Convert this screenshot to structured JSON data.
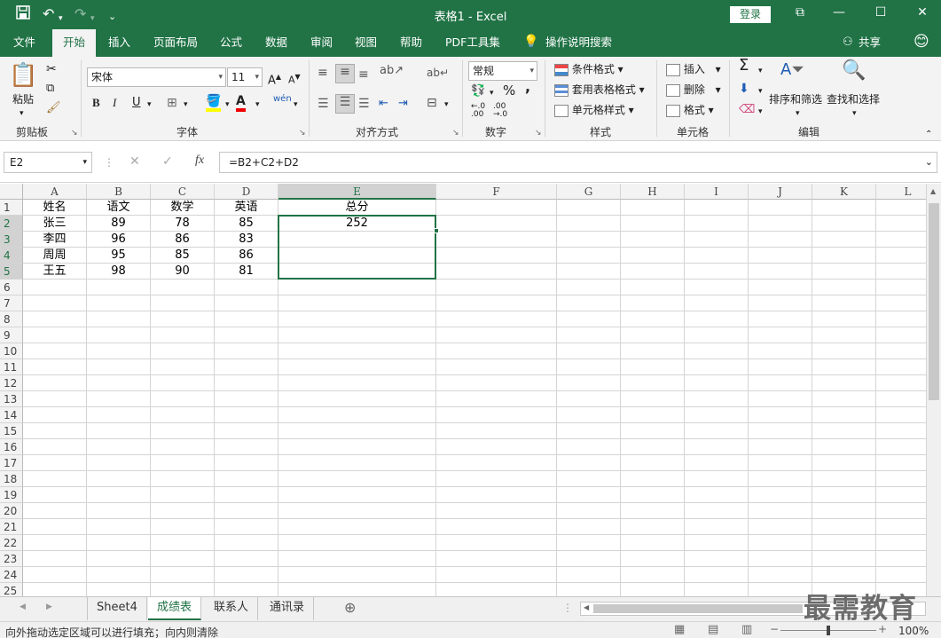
{
  "titlebar": {
    "title": "表格1  -  Excel",
    "login": "登录",
    "save_icon": "save-icon",
    "undo_icon": "undo-icon",
    "redo_icon": "redo-icon"
  },
  "tabs": [
    "文件",
    "开始",
    "插入",
    "页面布局",
    "公式",
    "数据",
    "审阅",
    "视图",
    "帮助",
    "PDF工具集",
    "操作说明搜索"
  ],
  "share": "共享",
  "ribbon": {
    "clipboard": {
      "paste": "粘贴",
      "label": "剪贴板"
    },
    "font": {
      "name": "宋体",
      "size": "11",
      "label": "字体",
      "bold": "B",
      "italic": "I",
      "underline": "U"
    },
    "alignment": {
      "label": "对齐方式"
    },
    "number": {
      "format": "常规",
      "label": "数字",
      "percent": "%",
      "comma": ","
    },
    "styles": {
      "conditional": "条件格式",
      "table": "套用表格格式",
      "cell": "单元格样式",
      "label": "样式"
    },
    "cells": {
      "insert": "插入",
      "delete": "删除",
      "format": "格式",
      "label": "单元格"
    },
    "editing": {
      "sort": "排序和筛选",
      "find": "查找和选择",
      "label": "编辑"
    }
  },
  "formula_bar": {
    "name_box": "E2",
    "formula": "=B2+C2+D2",
    "fx": "fx"
  },
  "columns": [
    "A",
    "B",
    "C",
    "D",
    "E",
    "F",
    "G",
    "H",
    "I",
    "J",
    "K",
    "L"
  ],
  "rows": [
    "1",
    "2",
    "3",
    "4",
    "5",
    "6",
    "7",
    "8",
    "9",
    "10",
    "11",
    "12",
    "13",
    "14",
    "15",
    "16",
    "17",
    "18",
    "19",
    "20",
    "21",
    "22",
    "23",
    "24",
    "25"
  ],
  "table": [
    [
      "姓名",
      "语文",
      "数学",
      "英语",
      "总分"
    ],
    [
      "张三",
      "89",
      "78",
      "85",
      "252"
    ],
    [
      "李四",
      "96",
      "86",
      "83",
      ""
    ],
    [
      "周周",
      "95",
      "85",
      "86",
      ""
    ],
    [
      "王五",
      "98",
      "90",
      "81",
      ""
    ]
  ],
  "sheets": [
    "Sheet4",
    "成绩表",
    "联系人",
    "通讯录"
  ],
  "active_sheet": "成绩表",
  "status": {
    "message": "向外拖动选定区域可以进行填充；向内则清除",
    "zoom": "100%"
  },
  "watermark": "最需教育",
  "colors": {
    "accent": "#217346"
  }
}
